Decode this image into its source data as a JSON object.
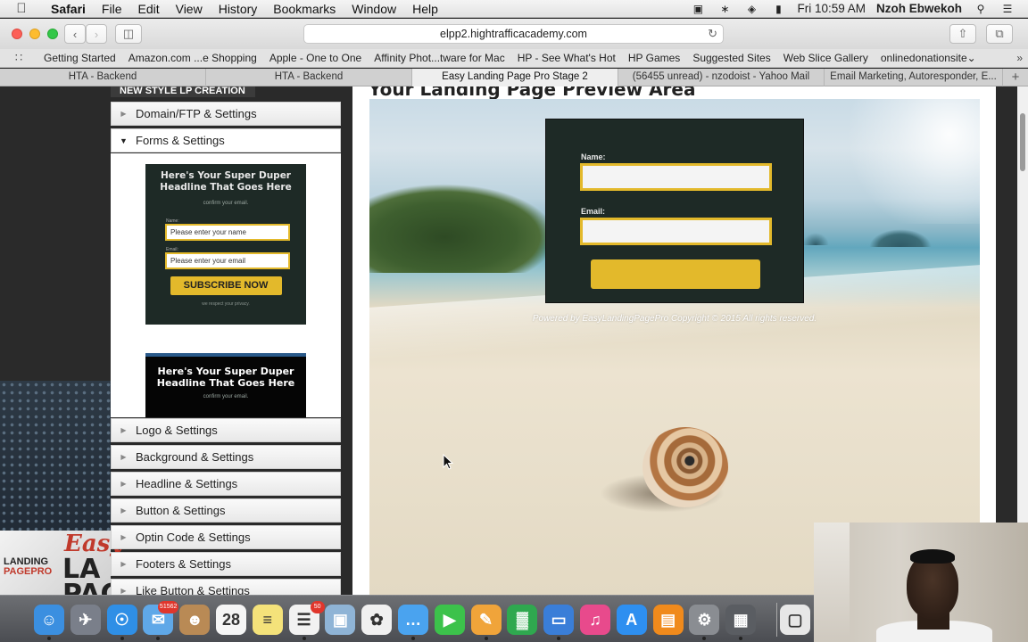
{
  "menubar": {
    "apple": "",
    "app_name": "Safari",
    "items": [
      "File",
      "Edit",
      "View",
      "History",
      "Bookmarks",
      "Window",
      "Help"
    ],
    "status_icons": [
      "facetime-camera-icon",
      "bluetooth-icon",
      "wifi-icon",
      "battery-icon"
    ],
    "clock": "Fri 10:59 AM",
    "user": "Nzoh Ebwekoh"
  },
  "toolbar": {
    "url": "elpp2.hightrafficacademy.com"
  },
  "bookmarks": {
    "items": [
      "Getting Started",
      "Amazon.com ...e Shopping",
      "Apple - One to One",
      "Affinity Phot...tware for Mac",
      "HP - See What's Hot",
      "HP Games",
      "Suggested Sites",
      "Web Slice Gallery",
      "onlinedonationsite⌄"
    ]
  },
  "tabs": {
    "items": [
      "HTA - Backend",
      "HTA - Backend",
      "Easy Landing Page Pro Stage 2",
      "(56455 unread) - nzodoist - Yahoo Mail",
      "Email Marketing, Autoresponder, E..."
    ],
    "active_index": 2
  },
  "sidebar": {
    "header": "NEW STYLE LP CREATION",
    "sections": [
      {
        "label": "Domain/FTP & Settings",
        "expanded": false
      },
      {
        "label": "Forms & Settings",
        "expanded": true
      },
      {
        "label": "Logo & Settings",
        "expanded": false
      },
      {
        "label": "Background & Settings",
        "expanded": false
      },
      {
        "label": "Headline & Settings",
        "expanded": false
      },
      {
        "label": "Button & Settings",
        "expanded": false
      },
      {
        "label": "Optin Code & Settings",
        "expanded": false
      },
      {
        "label": "Footers & Settings",
        "expanded": false
      },
      {
        "label": "Like Button & Settings",
        "expanded": false
      }
    ],
    "template1": {
      "headline": "Here's Your Super Duper Headline That Goes Here",
      "subline": "confirm your email.",
      "name_label": "Name:",
      "name_placeholder": "Please enter your name",
      "email_label": "Email:",
      "email_placeholder": "Please enter your email",
      "button": "SUBSCRIBE NOW",
      "privacy": "we respect your privacy."
    },
    "template2": {
      "headline": "Here's Your Super Duper Headline That Goes Here",
      "subline": "confirm your email."
    }
  },
  "background_logo": {
    "easy": "Easy",
    "landing": "LANDING",
    "pagepro": "PAGEPRO",
    "big": "LA PAC"
  },
  "preview": {
    "title": "Your Landing Page Preview Area",
    "form": {
      "name_label": "Name:",
      "email_label": "Email:"
    },
    "powered": "Powered by EasyLandingPagePro Copyright © 2015 All rights reserved."
  },
  "dock": {
    "apps": [
      {
        "name": "finder",
        "color": "#3b8fe0",
        "glyph": "☺"
      },
      {
        "name": "launchpad",
        "color": "#7a7f8a",
        "glyph": "✈"
      },
      {
        "name": "safari",
        "color": "#2f8fe6",
        "glyph": "☉"
      },
      {
        "name": "mail",
        "color": "#5fa8e8",
        "glyph": "✉",
        "badge": "51562"
      },
      {
        "name": "contacts",
        "color": "#b98a55",
        "glyph": "☻"
      },
      {
        "name": "calendar",
        "color": "#f5f5f5",
        "glyph": "28"
      },
      {
        "name": "notes",
        "color": "#f4e27a",
        "glyph": "≡"
      },
      {
        "name": "reminders",
        "color": "#f2f2f2",
        "glyph": "☰",
        "badge": "50"
      },
      {
        "name": "preview",
        "color": "#8fb4d6",
        "glyph": "▣"
      },
      {
        "name": "photos",
        "color": "#f0f0f0",
        "glyph": "✿"
      },
      {
        "name": "messages",
        "color": "#4aa3ef",
        "glyph": "…"
      },
      {
        "name": "facetime",
        "color": "#3cc24b",
        "glyph": "▶"
      },
      {
        "name": "pages",
        "color": "#f0a43a",
        "glyph": "✎"
      },
      {
        "name": "numbers",
        "color": "#2fa84f",
        "glyph": "▓"
      },
      {
        "name": "keynote",
        "color": "#3a7ed8",
        "glyph": "▭"
      },
      {
        "name": "itunes",
        "color": "#e84a8c",
        "glyph": "♫"
      },
      {
        "name": "app-store",
        "color": "#2e8ff0",
        "glyph": "A"
      },
      {
        "name": "ibooks",
        "color": "#f08a1c",
        "glyph": "▤"
      },
      {
        "name": "system-preferences",
        "color": "#8a8d92",
        "glyph": "⚙"
      },
      {
        "name": "video-app",
        "color": "#5a5d62",
        "glyph": "▦"
      },
      {
        "name": "documents",
        "color": "#e7e7e7",
        "glyph": "▢"
      }
    ]
  },
  "colors": {
    "accent_yellow": "#e3b92b",
    "form_bg": "#1e2a26"
  }
}
